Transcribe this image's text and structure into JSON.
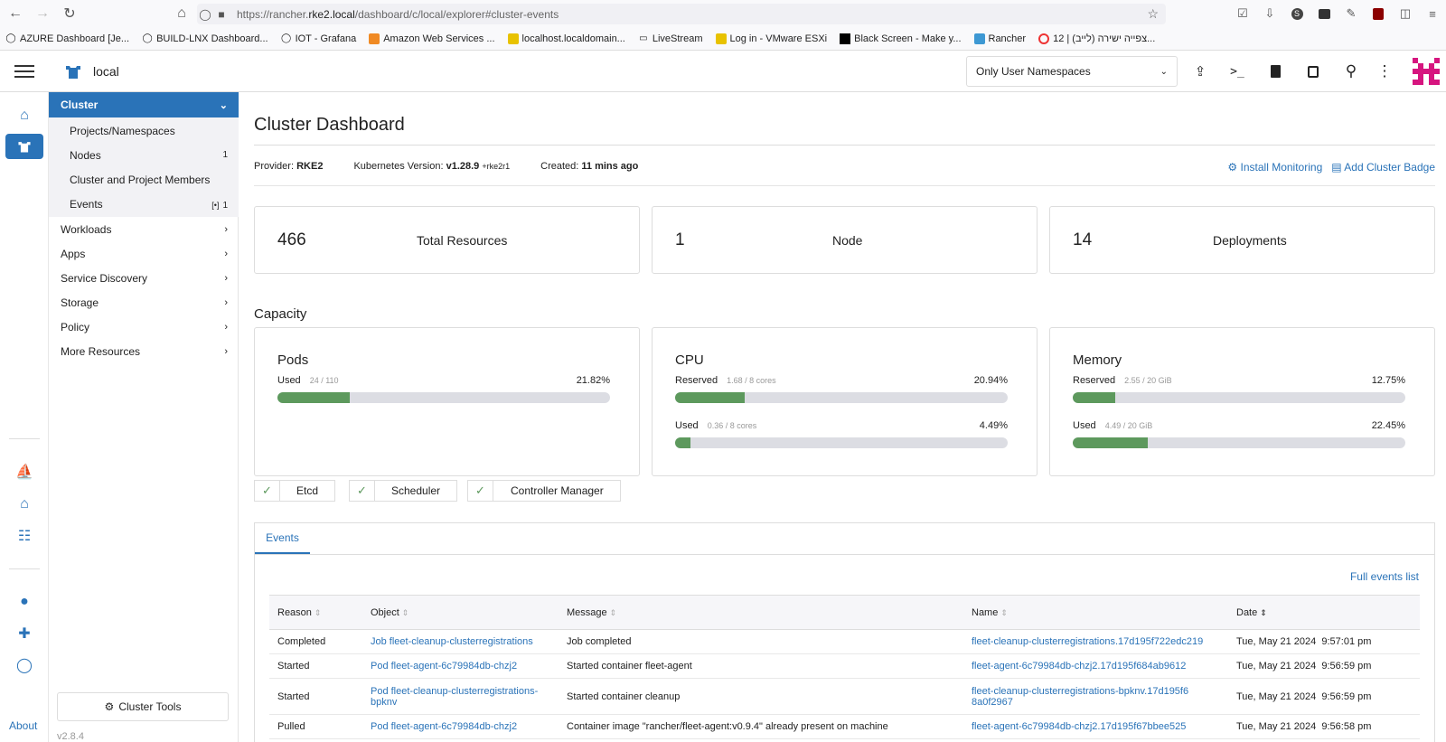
{
  "browser": {
    "url_prefix": "https://rancher.",
    "url_host": "rke2.local",
    "url_path": "/dashboard/c/local/explorer#cluster-events",
    "bookmarks": [
      "AZURE Dashboard [Je...",
      "BUILD-LNX Dashboard...",
      "IOT - Grafana",
      "Amazon Web Services ...",
      "localhost.localdomain...",
      "LiveStream",
      "Log in - VMware ESXi",
      "Black Screen - Make y...",
      "Rancher",
      "12 | צפייה ישירה (לייב)..."
    ]
  },
  "header": {
    "cluster_name": "local",
    "namespace_filter": "Only User Namespaces"
  },
  "sidenav": {
    "group_label": "Cluster",
    "subitems": [
      {
        "label": "Projects/Namespaces",
        "count": ""
      },
      {
        "label": "Nodes",
        "count": "1"
      },
      {
        "label": "Cluster and Project Members",
        "count": ""
      },
      {
        "label": "Events",
        "count": "1"
      }
    ],
    "items": [
      "Workloads",
      "Apps",
      "Service Discovery",
      "Storage",
      "Policy",
      "More Resources"
    ],
    "cluster_tools": "Cluster Tools",
    "version": "v2.8.4",
    "about": "About"
  },
  "main": {
    "title": "Cluster Dashboard",
    "provider_label": "Provider:",
    "provider": "RKE2",
    "k8s_label": "Kubernetes Version:",
    "k8s_version": "v1.28.9",
    "k8s_suffix": "+rke2r1",
    "created_label": "Created:",
    "created": "11 mins ago",
    "install_monitoring": "Install Monitoring",
    "add_badge": "Add Cluster Badge",
    "counts": [
      {
        "value": "466",
        "label": "Total Resources"
      },
      {
        "value": "1",
        "label": "Node"
      },
      {
        "value": "14",
        "label": "Deployments"
      }
    ],
    "capacity_title": "Capacity",
    "capacity": {
      "pods": {
        "title": "Pods",
        "used_label": "Used",
        "used_detail": "24 / 110",
        "used_pct": "21.82%",
        "used_fraction": 0.2182
      },
      "cpu": {
        "title": "CPU",
        "reserved_label": "Reserved",
        "reserved_detail": "1.68 / 8 cores",
        "reserved_pct": "20.94%",
        "reserved_fraction": 0.2094,
        "used_label": "Used",
        "used_detail": "0.36 / 8 cores",
        "used_pct": "4.49%",
        "used_fraction": 0.0449
      },
      "memory": {
        "title": "Memory",
        "reserved_label": "Reserved",
        "reserved_detail": "2.55 / 20 GiB",
        "reserved_pct": "12.75%",
        "reserved_fraction": 0.1275,
        "used_label": "Used",
        "used_detail": "4.49 / 20 GiB",
        "used_pct": "22.45%",
        "used_fraction": 0.2245
      }
    },
    "components": [
      "Etcd",
      "Scheduler",
      "Controller Manager"
    ],
    "events_tab": "Events",
    "full_events": "Full events list",
    "table": {
      "headers": [
        "Reason",
        "Object",
        "Message",
        "Name",
        "Date"
      ],
      "rows": [
        {
          "reason": "Completed",
          "object": "Job fleet-cleanup-clusterregistrations",
          "message": "Job completed",
          "name": "fleet-cleanup-clusterregistrations.17d195f722edc219",
          "date": "Tue, May 21 2024  9:57:01 pm"
        },
        {
          "reason": "Started",
          "object": "Pod fleet-agent-6c79984db-chzj2",
          "message": "Started container fleet-agent",
          "name": "fleet-agent-6c79984db-chzj2.17d195f684ab9612",
          "date": "Tue, May 21 2024  9:56:59 pm"
        },
        {
          "reason": "Started",
          "object": "Pod fleet-cleanup-clusterregistrations-bpknv",
          "message": "Started container cleanup",
          "name": "fleet-cleanup-clusterregistrations-bpknv.17d195f68a0f2967",
          "date": "Tue, May 21 2024  9:56:59 pm"
        },
        {
          "reason": "Pulled",
          "object": "Pod fleet-agent-6c79984db-chzj2",
          "message": "Container image \"rancher/fleet-agent:v0.9.4\" already present on machine",
          "name": "fleet-agent-6c79984db-chzj2.17d195f67bbee525",
          "date": "Tue, May 21 2024  9:56:58 pm"
        }
      ]
    }
  },
  "colors": {
    "accent": "#2a73b8",
    "bar_fill": "#5d995d",
    "bar_track": "#dcdde3",
    "ok": "#5d995d"
  }
}
